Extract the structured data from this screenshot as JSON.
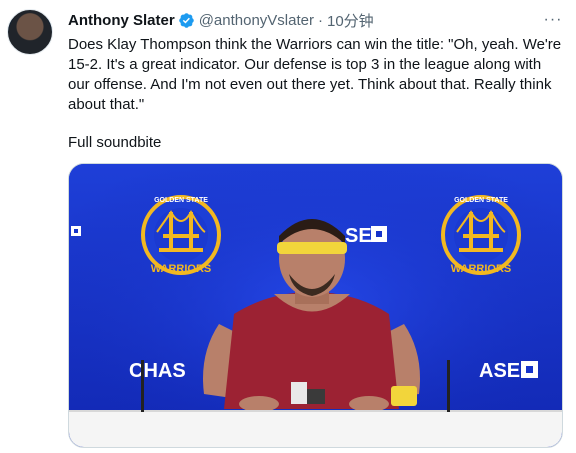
{
  "tweet": {
    "author_name": "Anthony Slater",
    "handle": "@anthonyVslater",
    "separator": "·",
    "timestamp": "10分钟",
    "text": "Does Klay Thompson think the Warriors can win the title: \"Oh, yeah. We're 15-2. It's a great indicator. Our defense is top 3 in the league along with our offense. And I'm not even out there yet. Think about that. Really think about that.\"",
    "subtext": "Full soundbite",
    "more_label": "···"
  },
  "media": {
    "backdrop": {
      "sponsor_left": "CHAS",
      "sponsor_right": "ASE",
      "sponsor_top": "SE",
      "logo_top_text": "GOLDEN STATE",
      "logo_bottom_text": "WARRIORS"
    }
  },
  "colors": {
    "backdrop_blue": "#1533c9",
    "logo_gold": "#f2b821",
    "verified_blue": "#1d9bf0",
    "muted_text": "#536471"
  },
  "icons": {
    "verified": "verified-badge-icon",
    "more": "more-options-icon"
  }
}
